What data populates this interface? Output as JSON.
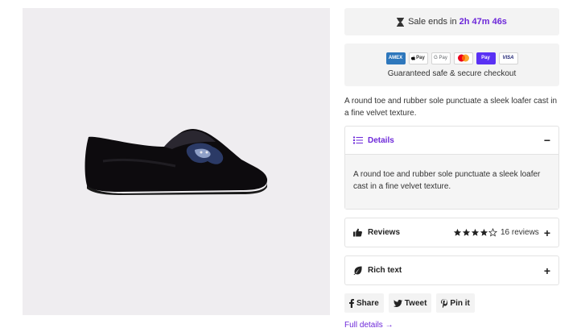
{
  "sale": {
    "label": "Sale ends in",
    "timer": "2h 47m 46s",
    "icon": "hourglass-icon"
  },
  "payment": {
    "icons": [
      "AMEX",
      "Pay",
      "G Pay",
      "mastercard",
      "Pay",
      "VISA"
    ],
    "guarantee": "Guaranteed safe & secure checkout"
  },
  "description": "A round toe and rubber sole punctuate a sleek loafer cast in a fine velvet texture.",
  "details": {
    "title": "Details",
    "toggle": "−",
    "body": "A round toe and rubber sole punctuate a sleek loafer cast in a fine velvet texture."
  },
  "reviews": {
    "title": "Reviews",
    "rating": 4,
    "max_rating": 5,
    "count_text": "16 reviews",
    "toggle": "+"
  },
  "rich_text": {
    "title": "Rich text",
    "toggle": "+"
  },
  "share": {
    "facebook": "Share",
    "twitter": "Tweet",
    "pinterest": "Pin it"
  },
  "full_details": "Full details →",
  "colors": {
    "accent": "#6d28d9",
    "panel": "#f3f3f3",
    "image_bg": "#efedf0"
  }
}
